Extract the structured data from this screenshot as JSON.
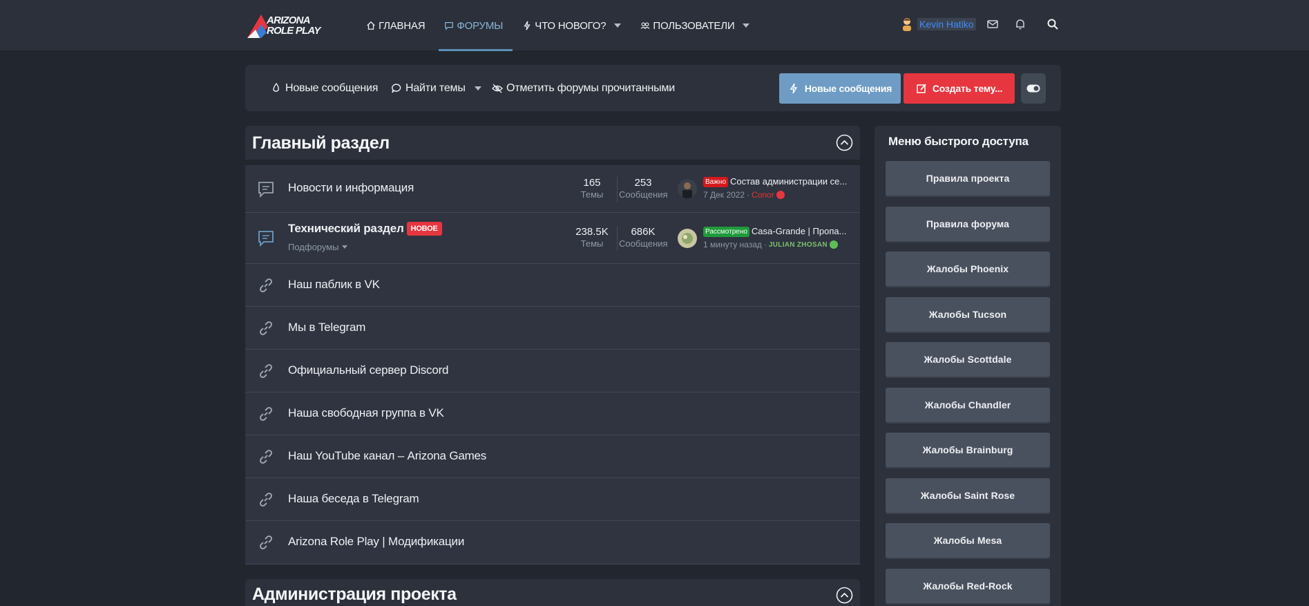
{
  "logo": {
    "line1": "ARIZONA",
    "line2": "ROLE PLAY"
  },
  "nav": {
    "items": [
      {
        "label": "ГЛАВНАЯ",
        "icon": "home-icon"
      },
      {
        "label": "ФОРУМЫ",
        "icon": "chat-icon",
        "active": true
      },
      {
        "label": "ЧТО НОВОГО?",
        "icon": "bolt-icon"
      },
      {
        "label": "ПОЛЬЗОВАТЕЛИ",
        "icon": "users-icon"
      }
    ],
    "user_name": "Kevin Hatiko"
  },
  "actionbar": {
    "new_posts": "Новые сообщения",
    "find_threads": "Найти темы",
    "mark_read": "Отметить форумы прочитанными",
    "btn_new_posts": "Новые сообщения",
    "btn_create_thread": "Создать тему..."
  },
  "sections": {
    "main": "Главный раздел",
    "admin": "Администрация проекта"
  },
  "forums": [
    {
      "title": "Новости и информация",
      "threads": "165",
      "threads_label": "Темы",
      "messages": "253",
      "messages_label": "Сообщения",
      "prefix": "Важно",
      "last_title": "Состав администрации се...",
      "last_date": "7 Дек 2022",
      "last_user": "Conor"
    },
    {
      "title": "Технический раздел",
      "badge": "НОВОЕ",
      "sub": "Подфорумы",
      "threads": "238.5K",
      "threads_label": "Темы",
      "messages": "686K",
      "messages_label": "Сообщения",
      "prefix": "Рассмотрено",
      "last_title": "Casa-Grande | Пропа...",
      "last_date": "1 минуту назад",
      "last_user": "JULIAN ZHOSAN"
    }
  ],
  "links": [
    "Наш паблик в VK",
    "Мы в Telegram",
    "Официальный сервер Discord",
    "Наша свободная группа в VK",
    "Наш YouTube канал – Arizona Games",
    "Наша беседа в Telegram",
    "Arizona Role Play | Модификации"
  ],
  "sidebar": {
    "title": "Меню быстрого доступа",
    "buttons": [
      "Правила проекта",
      "Правила форума",
      "Жалобы Phoenix",
      "Жалобы Tucson",
      "Жалобы Scottdale",
      "Жалобы Chandler",
      "Жалобы Brainburg",
      "Жалобы Saint Rose",
      "Жалобы Mesa",
      "Жалобы Red-Rock"
    ]
  },
  "colors": {
    "accent_blue": "#6e9cc4",
    "accent_red": "#e6363f",
    "background": "#22272f"
  }
}
